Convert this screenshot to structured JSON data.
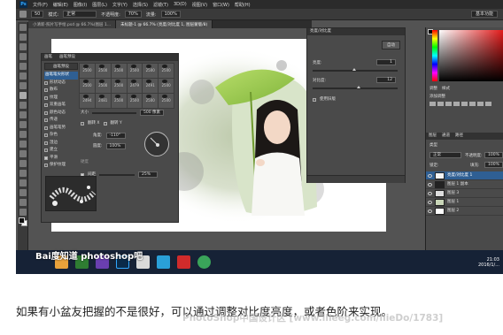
{
  "app": {
    "logo": "Ps",
    "menu": [
      "文件(F)",
      "编辑(E)",
      "图像(I)",
      "图层(L)",
      "文字(Y)",
      "选择(S)",
      "滤镜(T)",
      "3D(D)",
      "视图(V)",
      "窗口(W)",
      "帮助(H)"
    ],
    "options": {
      "size": "50",
      "mode_label": "模式:",
      "mode": "正常",
      "opacity_label": "不透明度:",
      "opacity": "70%",
      "flow_label": "流量:",
      "flow": "100%"
    },
    "workspace": "基本功能"
  },
  "tabs": [
    {
      "label": "小清新-照片写手绘.psd @ 66.7%(图层 1...",
      "active": false
    },
    {
      "label": "未标题-1 @ 66.7% (亮度/对比度 1, 图层蒙版/8)",
      "active": true
    }
  ],
  "brush_panel": {
    "tabs": [
      "画笔",
      "画笔预设"
    ],
    "preset_button": "画笔预设",
    "options": [
      {
        "label": "画笔笔尖形状",
        "checked": false,
        "selected": true
      },
      {
        "label": "形状动态",
        "checked": true,
        "selected": false
      },
      {
        "label": "散布",
        "checked": true,
        "selected": false
      },
      {
        "label": "纹理",
        "checked": false,
        "selected": false
      },
      {
        "label": "双重画笔",
        "checked": false,
        "selected": false
      },
      {
        "label": "颜色动态",
        "checked": false,
        "selected": false
      },
      {
        "label": "传递",
        "checked": false,
        "selected": false
      },
      {
        "label": "画笔笔势",
        "checked": false,
        "selected": false
      },
      {
        "label": "杂色",
        "checked": false,
        "selected": false
      },
      {
        "label": "湿边",
        "checked": false,
        "selected": false
      },
      {
        "label": "建立",
        "checked": false,
        "selected": false
      },
      {
        "label": "平滑",
        "checked": true,
        "selected": false
      },
      {
        "label": "保护纹理",
        "checked": false,
        "selected": false
      }
    ],
    "brush_sizes": [
      "2500",
      "2500",
      "2500",
      "2500",
      "2500",
      "2500",
      "2500",
      "2500",
      "2500",
      "2479",
      "2491",
      "2500",
      "2494",
      "2481",
      "2500",
      "2500",
      "2500",
      "2500"
    ],
    "size_label": "大小",
    "size_value": "500 像素",
    "flip_x": "翻转 X",
    "flip_y": "翻转 Y",
    "angle_label": "角度:",
    "angle_value": "-110°",
    "roundness_label": "圆度:",
    "roundness_value": "100%",
    "hardness_label": "硬度",
    "spacing_label": "间距",
    "spacing_value": "25%"
  },
  "adjust_panel": {
    "title": "亮度/对比度",
    "auto_button": "自动",
    "brightness_label": "亮度:",
    "brightness_value": "1",
    "contrast_label": "对比度:",
    "contrast_value": "12",
    "legacy_label": "使用旧版"
  },
  "right_dock": {
    "swatches_tabs": [
      "调整",
      "样式"
    ],
    "add_adjustment": "添加调整",
    "layer_tabs": [
      "图层",
      "通道",
      "路径"
    ],
    "kind_label": "类型",
    "blend_mode": "正常",
    "opacity_label": "不透明度:",
    "opacity_value": "100%",
    "lock_label": "锁定:",
    "fill_label": "填充:",
    "fill_value": "100%",
    "layers": [
      {
        "name": "亮度/对比度 1",
        "selected": true
      },
      {
        "name": "图层 1 副本",
        "selected": false
      },
      {
        "name": "图层 3",
        "selected": false
      },
      {
        "name": "图层 1",
        "selected": false
      },
      {
        "name": "图层 2",
        "selected": false
      }
    ]
  },
  "taskbar": {
    "time": "21:03",
    "date": "2016/1/..."
  },
  "watermark": "Bai度知道 photoshop吧",
  "caption": "如果有小盆友把握的不是很好，可以通过调整对比度亮度，或者色阶来实现。",
  "site_watermark": "PhotoShop中国设计区  [www.llieeg.com/llieDo/1783]"
}
